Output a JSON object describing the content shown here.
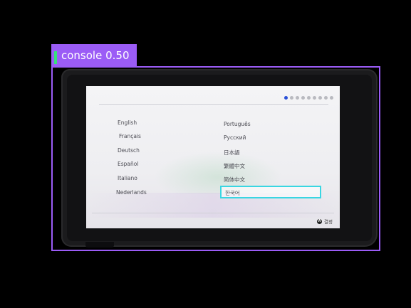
{
  "detection": {
    "label": "console 0.50",
    "box_color": "#9b5cf6"
  },
  "screen": {
    "languages_left": [
      "English",
      "Français",
      "Deutsch",
      "Español",
      "Italiano",
      "Nederlands"
    ],
    "languages_right": [
      "Português",
      "Русский",
      "日本語",
      "繁體中文",
      "简体中文",
      "한국어"
    ],
    "selected": "한국어",
    "page_indicator": {
      "total": 9,
      "current": 1
    },
    "ok_button": {
      "glyph": "A",
      "label": "결정"
    }
  },
  "colors": {
    "selection": "#39d6e2",
    "active_dot": "#2a50d8"
  }
}
